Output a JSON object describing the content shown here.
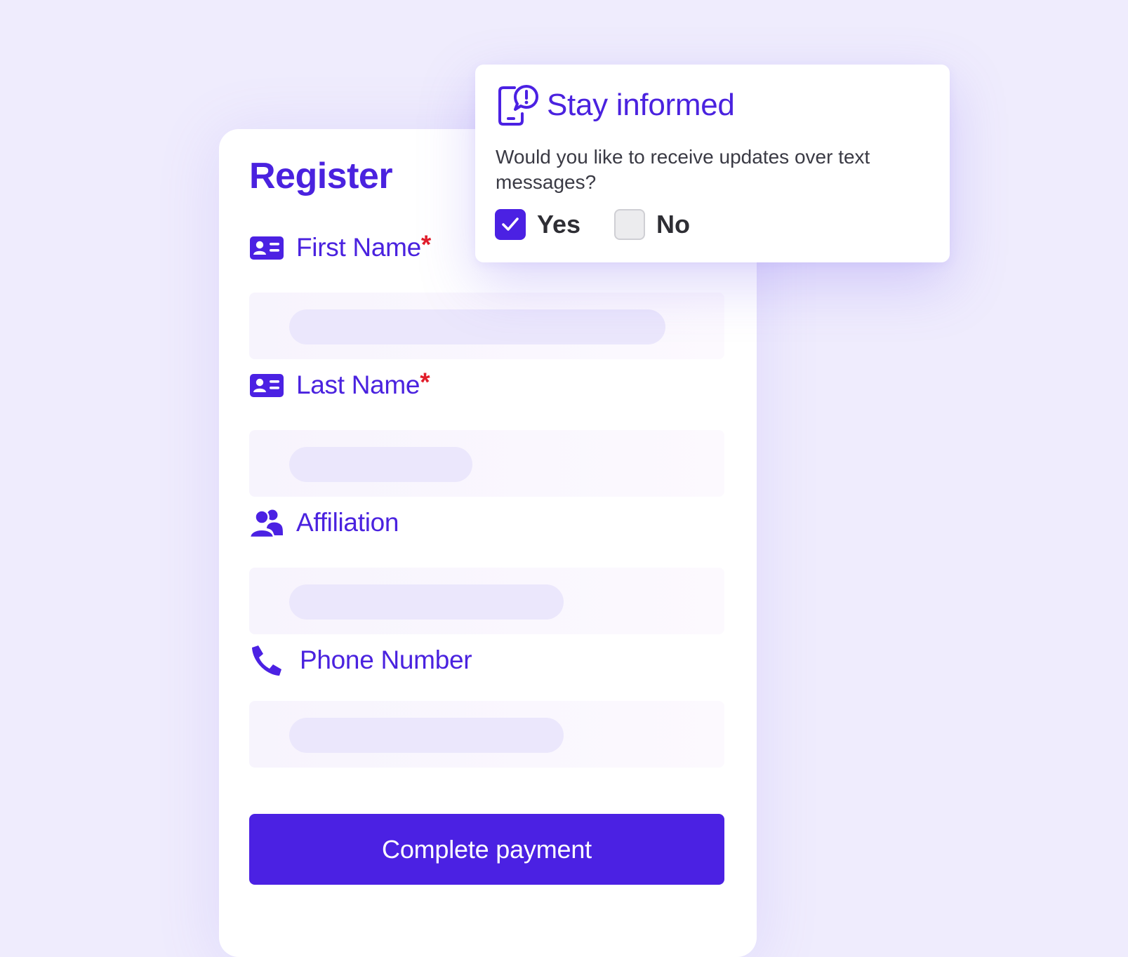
{
  "register_form": {
    "title": "Register",
    "fields": [
      {
        "label": "First Name",
        "required": true,
        "required_mark": "*",
        "icon": "id-card-icon",
        "skeleton_fill_fraction": 0.77
      },
      {
        "label": "Last Name",
        "required": true,
        "required_mark": "*",
        "icon": "id-card-icon",
        "skeleton_fill_fraction": 0.37
      },
      {
        "label": "Affiliation",
        "required": false,
        "icon": "users-icon",
        "skeleton_fill_fraction": 0.56
      },
      {
        "label": "Phone Number",
        "required": false,
        "icon": "phone-icon",
        "skeleton_fill_fraction": 0.56
      }
    ],
    "submit_label": "Complete payment"
  },
  "popup": {
    "title": "Stay informed",
    "icon": "phone-alert-icon",
    "question": "Would you like to receive updates over text messages?",
    "options": [
      {
        "label": "Yes",
        "checked": true
      },
      {
        "label": "No",
        "checked": false
      }
    ]
  },
  "colors": {
    "accent": "#4b21e3",
    "required": "#e11d2a",
    "background": "#efecfd"
  }
}
